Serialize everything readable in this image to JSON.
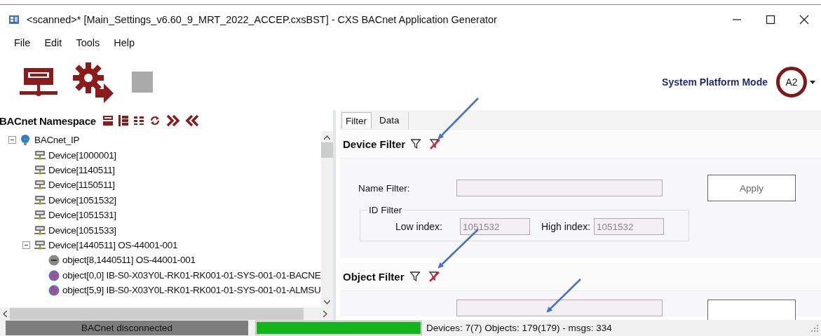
{
  "window": {
    "title": "<scanned>* [Main_Settings_v6.60_9_MRT_2022_ACCEP.cxsBST] - CXS BACnet Application Generator"
  },
  "menu": [
    "File",
    "Edit",
    "Tools",
    "Help"
  ],
  "mode": {
    "label": "System Platform Mode",
    "value": "A2"
  },
  "namespace": {
    "title": "BACnet Namespace",
    "tree": [
      {
        "label": "BACnet_IP",
        "kind": "network",
        "expanded": true,
        "children": [
          {
            "label": "Device[1000001]",
            "kind": "device"
          },
          {
            "label": "Device[1140511]",
            "kind": "device"
          },
          {
            "label": "Device[1150511]",
            "kind": "device"
          },
          {
            "label": "Device[1051532]",
            "kind": "device"
          },
          {
            "label": "Device[1051531]",
            "kind": "device"
          },
          {
            "label": "Device[1051533]",
            "kind": "device"
          },
          {
            "label": "Device[1440511] OS-44001-001",
            "kind": "device",
            "expanded": true,
            "children": [
              {
                "label": "object[8,1440511] OS-44001-001",
                "kind": "device-object"
              },
              {
                "label": "object[0,0] IB-S0-X03Y0L-RK01-RK001-01-SYS-001-01-BACNE",
                "kind": "analog-object"
              },
              {
                "label": "object[5,9] IB-S0-X03Y0L-RK01-RK001-01-SYS-001-01-ALMSU",
                "kind": "analog-object"
              }
            ]
          }
        ]
      }
    ]
  },
  "tabs": [
    {
      "label": "Filter",
      "selected": true
    },
    {
      "label": "Data",
      "selected": false
    }
  ],
  "device_filter": {
    "title": "Device Filter",
    "name_label": "Name Filter:",
    "apply": "Apply",
    "id_filter": {
      "title": "ID Filter",
      "low_label": "Low index:",
      "low_value": "1051532",
      "high_label": "High index:",
      "high_value": "1051532"
    }
  },
  "object_filter": {
    "title": "Object Filter"
  },
  "status_bar": {
    "connection": "BACnet disconnected",
    "progress": {
      "level": 1
    },
    "summary": "Devices: 7(7) Objects: 179(179) - msgs: 334"
  }
}
